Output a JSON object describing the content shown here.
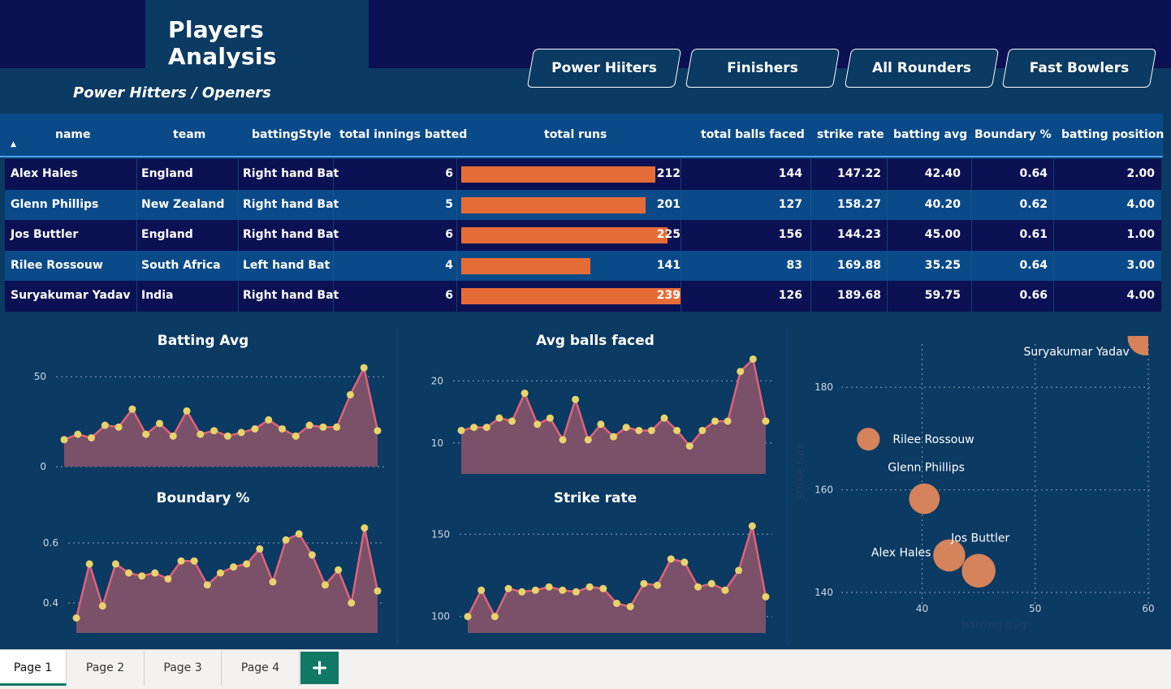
{
  "header": {
    "title": "Players Analysis",
    "subtitle": "Power Hitters / Openers",
    "nav_buttons": [
      "Power Hiiters",
      "Finishers",
      "All Rounders",
      "Fast Bowlers"
    ]
  },
  "table": {
    "columns": [
      "name",
      "team",
      "battingStyle",
      "total innings batted",
      "total runs",
      "total balls faced",
      "strike rate",
      "batting avg",
      "Boundary %",
      "batting position"
    ],
    "rows": [
      {
        "name": "Alex Hales",
        "team": "England",
        "style": "Right hand Bat",
        "innings": "6",
        "runs": "212",
        "balls": "144",
        "sr": "147.22",
        "avg": "42.40",
        "boundary": "0.64",
        "pos": "2.00"
      },
      {
        "name": "Glenn Phillips",
        "team": "New Zealand",
        "style": "Right hand Bat",
        "innings": "5",
        "runs": "201",
        "balls": "127",
        "sr": "158.27",
        "avg": "40.20",
        "boundary": "0.62",
        "pos": "4.00"
      },
      {
        "name": "Jos Buttler",
        "team": "England",
        "style": "Right hand Bat",
        "innings": "6",
        "runs": "225",
        "balls": "156",
        "sr": "144.23",
        "avg": "45.00",
        "boundary": "0.61",
        "pos": "1.00"
      },
      {
        "name": "Rilee Rossouw",
        "team": "South Africa",
        "style": "Left hand Bat",
        "innings": "4",
        "runs": "141",
        "balls": "83",
        "sr": "169.88",
        "avg": "35.25",
        "boundary": "0.64",
        "pos": "3.00"
      },
      {
        "name": "Suryakumar Yadav",
        "team": "India",
        "style": "Right hand Bat",
        "innings": "6",
        "runs": "239",
        "balls": "126",
        "sr": "189.68",
        "avg": "59.75",
        "boundary": "0.66",
        "pos": "4.00"
      }
    ],
    "bar_max": 239
  },
  "chart_data": [
    {
      "type": "area",
      "title": "Batting Avg",
      "ylim": [
        0,
        65
      ],
      "yticks": [
        "0",
        "50"
      ],
      "values": [
        15,
        18,
        16,
        23,
        22,
        32,
        18,
        24,
        17,
        31,
        18,
        20,
        17,
        19,
        21,
        26,
        21,
        17,
        23,
        22,
        22,
        40,
        55,
        20
      ]
    },
    {
      "type": "area",
      "title": "Avg balls faced",
      "ylim": [
        5,
        25
      ],
      "yticks": [
        "10",
        "20"
      ],
      "values": [
        12,
        12.5,
        12.5,
        14,
        13.5,
        18,
        13,
        14,
        10.5,
        17,
        10.5,
        13,
        11,
        12.5,
        12,
        12,
        14,
        12,
        9.5,
        12,
        13.5,
        13.5,
        21.5,
        23.5,
        13.5
      ]
    },
    {
      "type": "area",
      "title": "Boundary %",
      "ylim": [
        0.3,
        0.7
      ],
      "yticks": [
        "0.4",
        "0.6"
      ],
      "values": [
        0.35,
        0.53,
        0.39,
        0.53,
        0.5,
        0.49,
        0.5,
        0.48,
        0.54,
        0.54,
        0.46,
        0.5,
        0.52,
        0.53,
        0.58,
        0.47,
        0.61,
        0.63,
        0.56,
        0.46,
        0.51,
        0.4,
        0.65,
        0.44
      ]
    },
    {
      "type": "area",
      "title": "Strike rate",
      "ylim": [
        90,
        160
      ],
      "yticks": [
        "100",
        "150"
      ],
      "values": [
        100,
        116,
        100,
        117,
        115,
        116,
        118,
        116,
        115,
        118,
        117,
        108,
        106,
        120,
        119,
        135,
        133,
        118,
        120,
        116,
        128,
        155,
        112
      ]
    },
    {
      "type": "scatter",
      "title": "",
      "xlabel": "batting avg",
      "ylabel": "strike rate",
      "xlim": [
        33,
        60
      ],
      "ylim": [
        137,
        190
      ],
      "xticks": [
        "40",
        "50",
        "60"
      ],
      "yticks": [
        "140",
        "160",
        "180"
      ],
      "points": [
        {
          "name": "Suryakumar Yadav",
          "x": 59.75,
          "y": 189.68,
          "size": 239
        },
        {
          "name": "Rilee Rossouw",
          "x": 35.25,
          "y": 169.88,
          "size": 141
        },
        {
          "name": "Glenn Phillips",
          "x": 40.2,
          "y": 158.27,
          "size": 201
        },
        {
          "name": "Jos Buttler",
          "x": 45.0,
          "y": 144.23,
          "size": 225
        },
        {
          "name": "Alex Hales",
          "x": 42.4,
          "y": 147.22,
          "size": 212
        }
      ]
    }
  ],
  "tabs": {
    "pages": [
      "Page 1",
      "Page 2",
      "Page 3",
      "Page 4"
    ],
    "add": "+"
  },
  "colors": {
    "bar": "#e66c37",
    "line": "#e06379",
    "area": "#7b5069",
    "dot": "#e8d36a",
    "bubble": "#d4835a"
  }
}
